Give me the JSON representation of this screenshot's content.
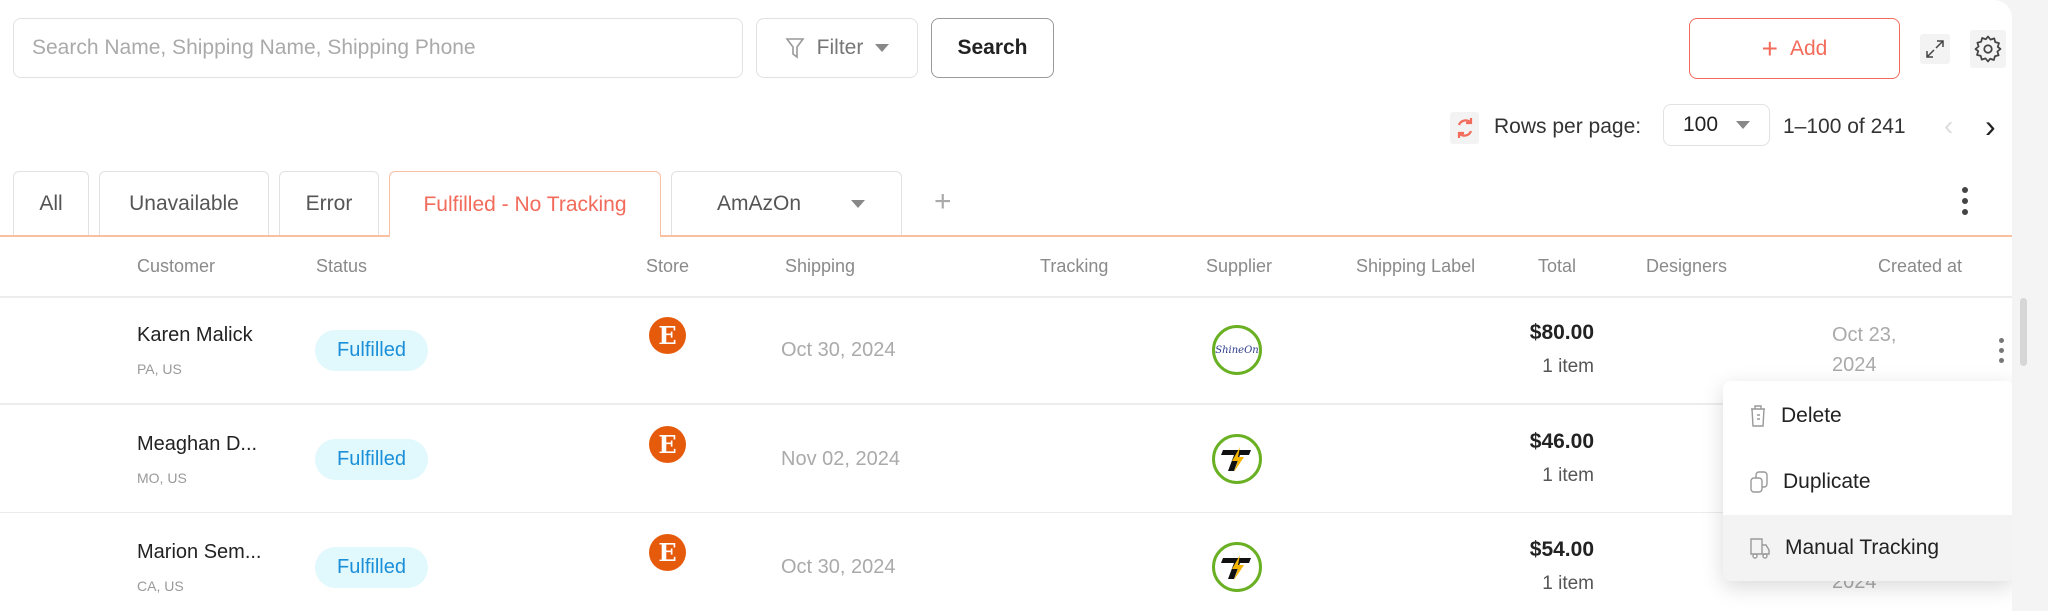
{
  "toolbar": {
    "search_placeholder": "Search Name, Shipping Name, Shipping Phone",
    "filter_label": "Filter",
    "search_label": "Search",
    "add_label": "Add"
  },
  "pagination": {
    "rows_per_page_label": "Rows per page:",
    "rows_per_page": "100",
    "range": "1–100 of 241"
  },
  "tabs": [
    {
      "label": "All"
    },
    {
      "label": "Unavailable"
    },
    {
      "label": "Error"
    },
    {
      "label": "Fulfilled - No Tracking",
      "active": true
    },
    {
      "label": "AmAzOn"
    }
  ],
  "columns": [
    "Customer",
    "Status",
    "Store",
    "Shipping",
    "Tracking",
    "Supplier",
    "Shipping Label",
    "Total",
    "Designers",
    "Created at"
  ],
  "rows": [
    {
      "name": "Karen Malick",
      "location": "PA, US",
      "status": "Fulfilled",
      "store": "E",
      "shipping": "Oct 30, 2024",
      "supplier": "ShineOn",
      "total": "$80.00",
      "items": "1 item",
      "created_line1": "Oct 23,",
      "created_line2": "2024"
    },
    {
      "name": "Meaghan D...",
      "location": "MO, US",
      "status": "Fulfilled",
      "store": "E",
      "shipping": "Nov 02, 2024",
      "supplier": "T",
      "total": "$46.00",
      "items": "1 item",
      "created_line1": "",
      "created_line2": ""
    },
    {
      "name": "Marion Sem...",
      "location": "CA, US",
      "status": "Fulfilled",
      "store": "E",
      "shipping": "Oct 30, 2024",
      "supplier": "T",
      "total": "$54.00",
      "items": "1 item",
      "created_line1": "",
      "created_line2": "2024"
    }
  ],
  "menu": {
    "items": [
      {
        "label": "Delete",
        "icon": "trash-icon"
      },
      {
        "label": "Duplicate",
        "icon": "copy-icon"
      },
      {
        "label": "Manual Tracking",
        "icon": "truck-icon",
        "highlighted": true
      }
    ]
  },
  "colors": {
    "accent": "#f26b5b",
    "status_bg": "#e1f8fd",
    "status_text": "#1b8fd8",
    "etsy": "#e65a0c",
    "supplier_ring": "#6ab023"
  }
}
